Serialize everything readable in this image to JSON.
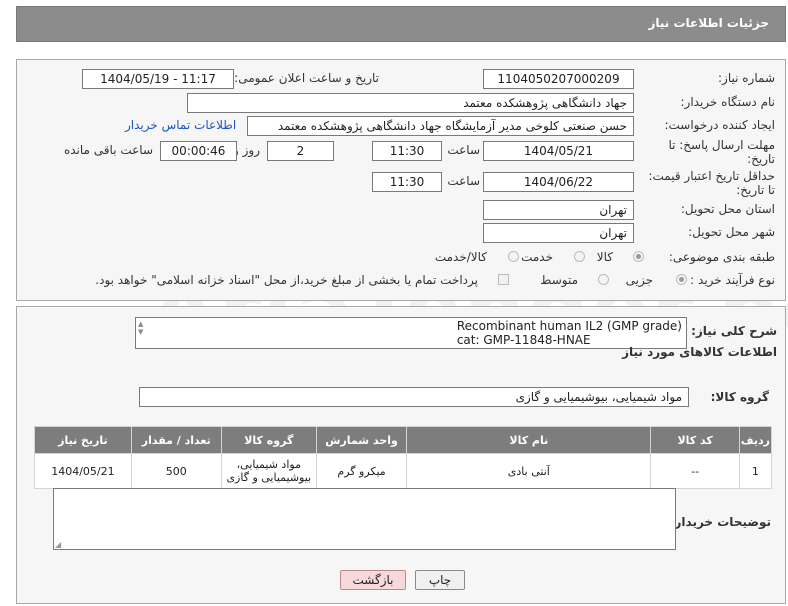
{
  "header": {
    "title": "جزئیات اطلاعات نیاز"
  },
  "form": {
    "need_number_label": "شماره نیاز:",
    "need_number": "1104050207000209",
    "announce_label": "تاریخ و ساعت اعلان عمومی:",
    "announce_value": "1404/05/19 - 11:17",
    "buyer_org_label": "نام دستگاه خریدار:",
    "buyer_org": "جهاد دانشگاهی پژوهشکده معتمد",
    "creator_label": "ایجاد کننده درخواست:",
    "creator": "حسن صنعتی کلوخی مدیر آزمایشگاه جهاد دانشگاهی پژوهشکده معتمد",
    "contact_link": "اطلاعات تماس خریدار",
    "reply_deadline_label": "مهلت ارسال پاسخ: تا تاریخ:",
    "reply_date": "1404/05/21",
    "time_label": "ساعت",
    "reply_time": "11:30",
    "days_value": "2",
    "days_label": "روز و",
    "remaining_time": "00:00:46",
    "remaining_label": "ساعت باقی مانده",
    "price_validity_label": "حداقل تاریخ اعتبار قیمت: تا تاریخ:",
    "price_date": "1404/06/22",
    "price_time": "11:30",
    "province_label": "استان محل تحویل:",
    "province": "تهران",
    "city_label": "شهر محل تحویل:",
    "city": "تهران",
    "category_label": "طبقه بندی موضوعی:",
    "category_options": [
      "کالا",
      "خدمت",
      "کالا/خدمت"
    ],
    "process_label": "نوع فرآیند خرید :",
    "process_options": [
      "جزیی",
      "متوسط"
    ],
    "payment_note": "پرداخت تمام یا بخشی از مبلغ خرید،از محل \"اسناد خزانه اسلامی\" خواهد بود."
  },
  "description": {
    "label": "شرح کلی نیاز:",
    "line1": "Recombinant human IL2 (GMP grade)",
    "line2": "cat: GMP-11848-HNAE"
  },
  "goods": {
    "section_title": "اطلاعات کالاهای مورد نیاز",
    "group_label": "گروه کالا:",
    "group_value": "مواد شیمیایی، بیوشیمیایی و  گازی",
    "headers": [
      "ردیف",
      "کد کالا",
      "نام کالا",
      "واحد شمارش",
      "گروه کالا",
      "تعداد / مقدار",
      "تاریخ نیاز"
    ],
    "rows": [
      {
        "row": "1",
        "code": "--",
        "name": "آنتی بادی",
        "unit": "میکرو گرم",
        "group_line1": "مواد شیمیایی،",
        "group_line2": "بیوشیمیایی و گازی",
        "qty": "500",
        "date": "1404/05/21"
      }
    ]
  },
  "buyer_notes": {
    "label": "توضیحات خریدار:"
  },
  "buttons": {
    "print": "چاپ",
    "back": "بازگشت"
  },
  "watermark": "AriaTender.neT"
}
